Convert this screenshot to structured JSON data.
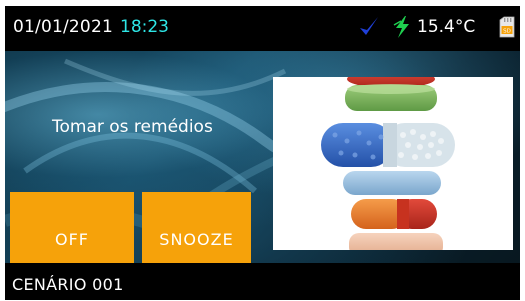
{
  "status_bar": {
    "date": "01/01/2021",
    "time": "18:23",
    "temperature": "15.4°C",
    "sd_label": "SD",
    "icons": [
      "check-icon",
      "lightning-icon",
      "sd-card-icon"
    ]
  },
  "alarm": {
    "message": "Tomar os remédios",
    "buttons": {
      "off_label": "OFF",
      "snooze_label": "SNOOZE"
    }
  },
  "footer": {
    "scenario": "CENÁRIO 001"
  },
  "colors": {
    "accent_button": "#f6a20a",
    "time_text": "#2ee6e6",
    "check_icon": "#1f3fd8",
    "bolt_icon": "#1fcf4f"
  }
}
